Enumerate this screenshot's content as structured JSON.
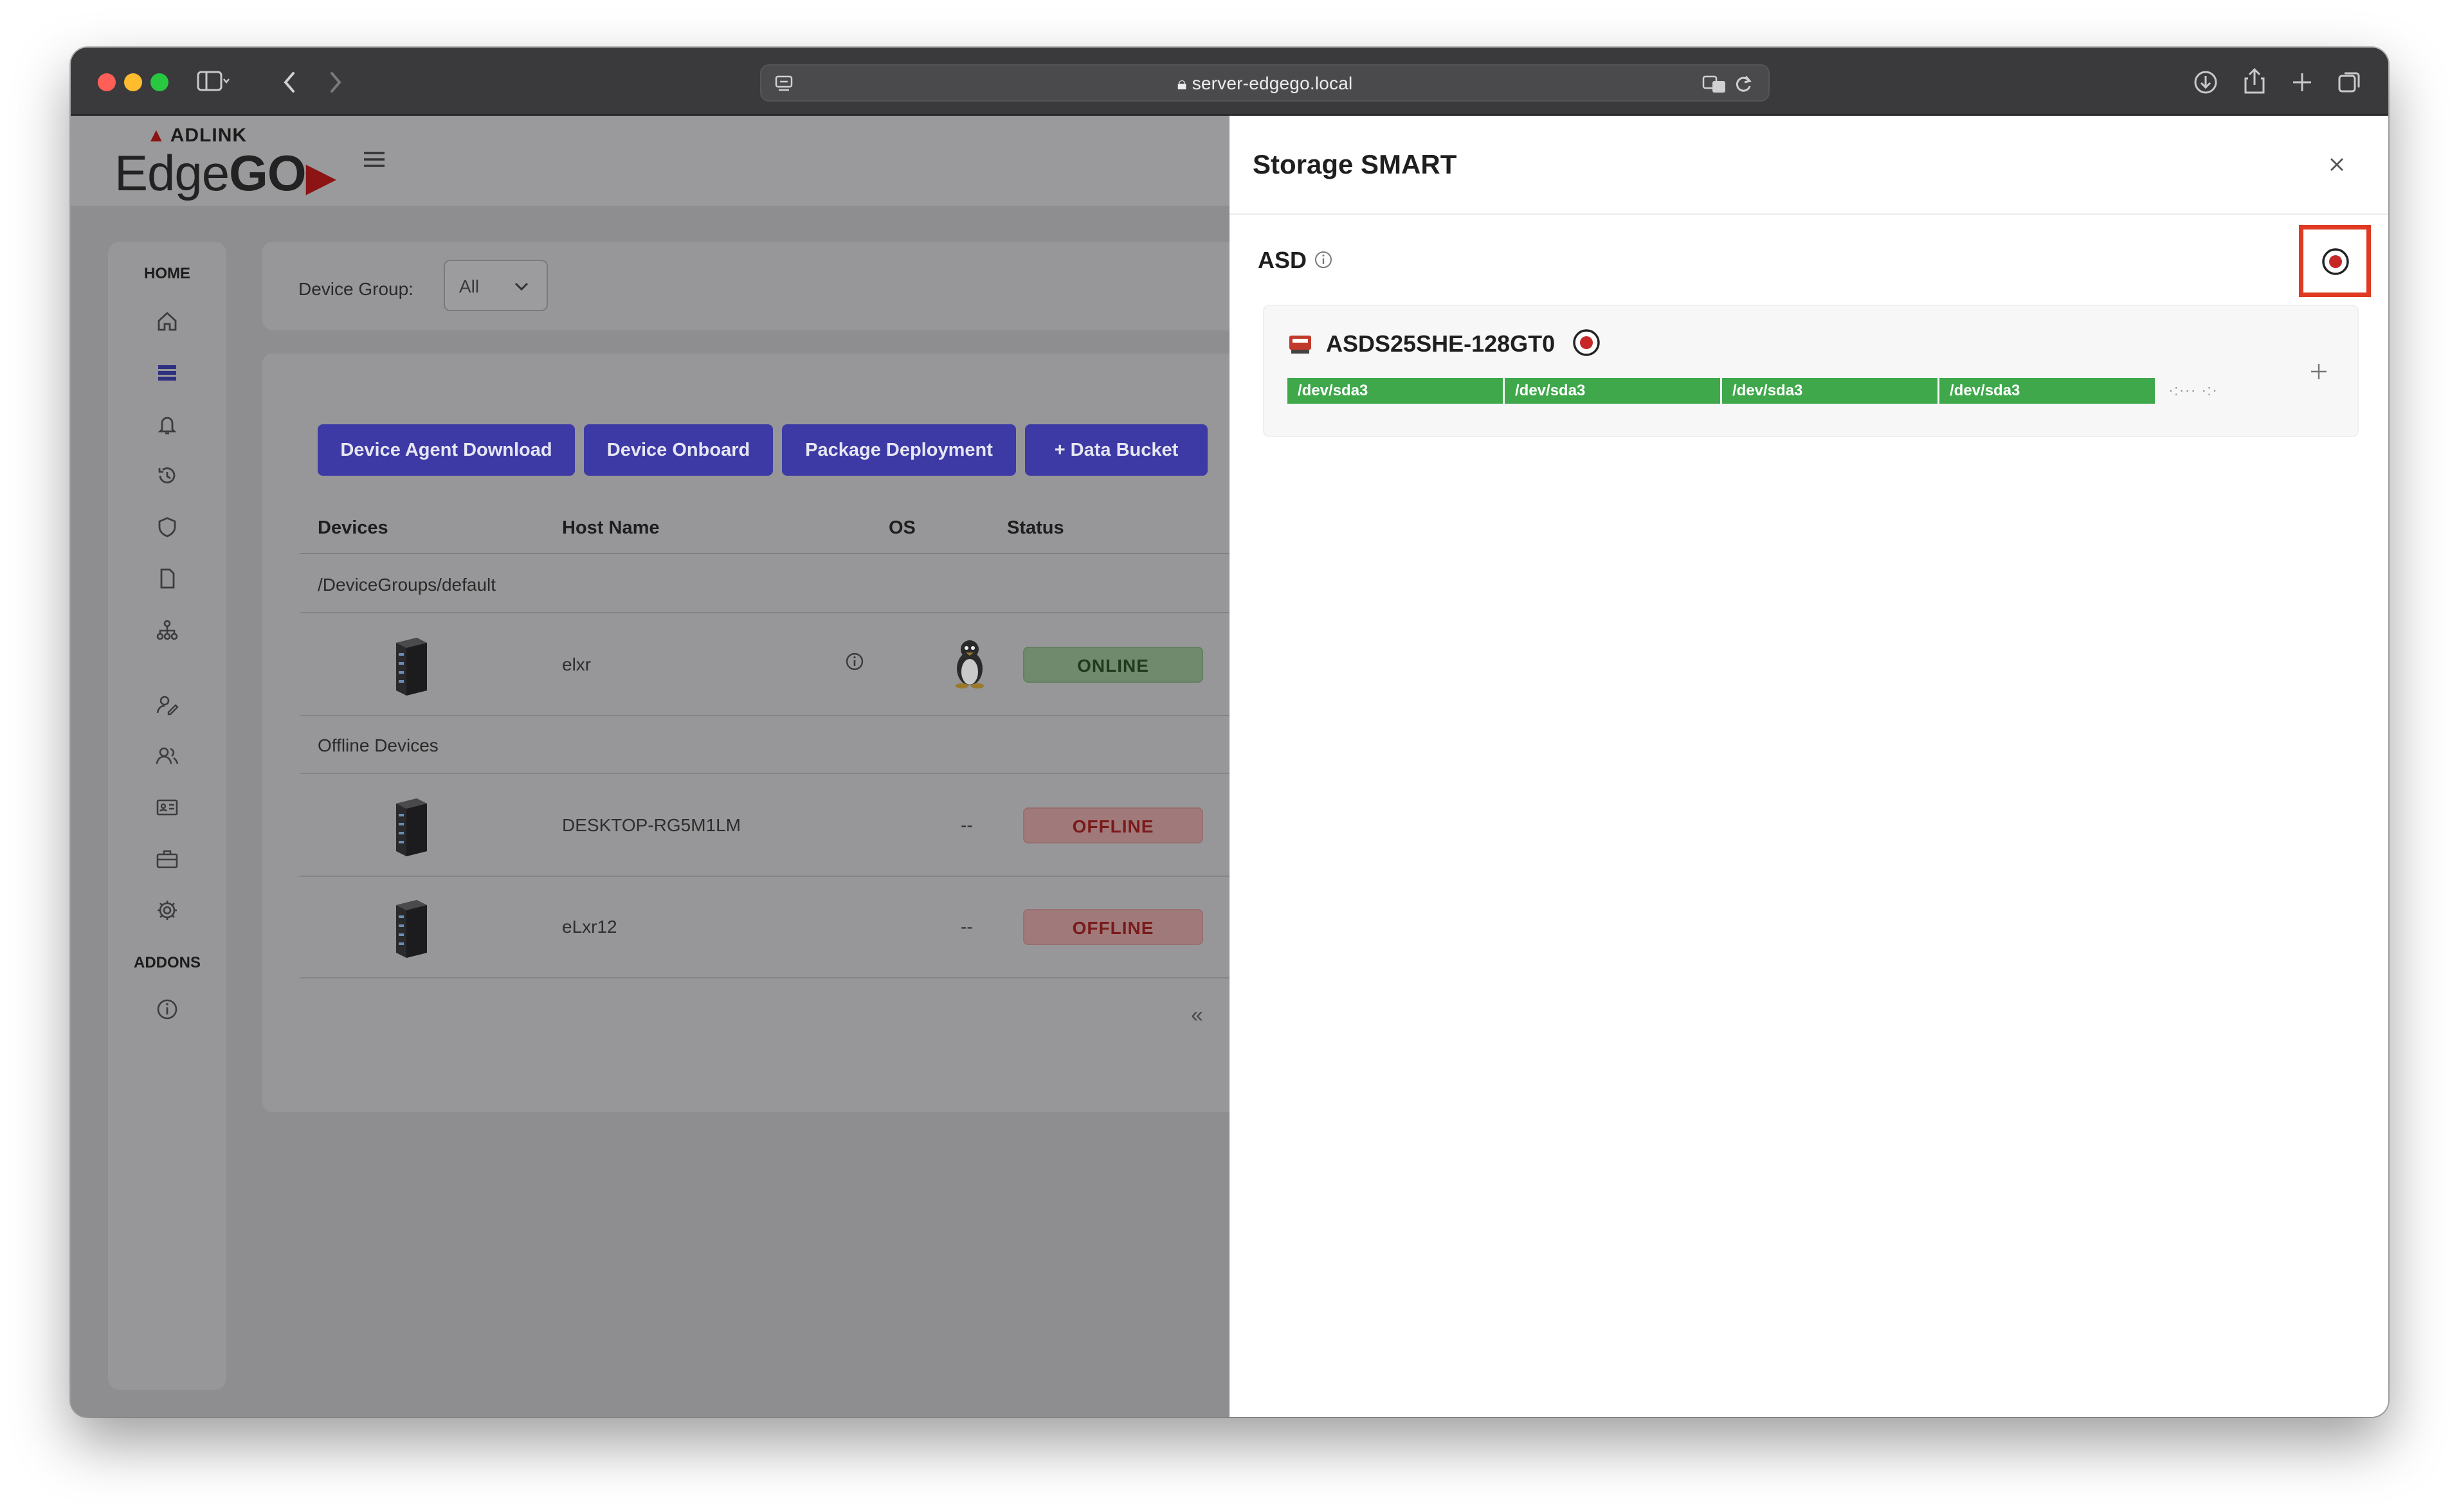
{
  "browser": {
    "url": "server-edgego.local"
  },
  "app": {
    "brand_small": "ADLINK",
    "brand_name_part1": "Edge",
    "brand_name_part2": "GO",
    "brand_arrow": "▶"
  },
  "sidebar": {
    "home_label": "HOME",
    "addons_label": "ADDONS",
    "icons": [
      "home-icon",
      "list-icon",
      "bell-icon",
      "history-icon",
      "shield-icon",
      "document-icon",
      "network-icon",
      "user-edit-icon",
      "users-icon",
      "id-card-icon",
      "briefcase-icon",
      "gear-icon",
      "info-icon"
    ]
  },
  "filter": {
    "label": "Device Group:",
    "value": "All"
  },
  "toolbar": {
    "agent_download": "Device Agent Download",
    "onboard": "Device Onboard",
    "package_deployment": "Package Deployment",
    "data_bucket": "+ Data Bucket"
  },
  "table": {
    "headers": [
      "Devices",
      "Host Name",
      "OS",
      "Status"
    ],
    "groups": [
      {
        "label": "/DeviceGroups/default",
        "rows": [
          {
            "host": "elxr",
            "os": "linux",
            "status": "ONLINE"
          }
        ]
      },
      {
        "label": "Offline Devices",
        "rows": [
          {
            "host": "DESKTOP-RG5M1LM",
            "os": "--",
            "status": "OFFLINE"
          },
          {
            "host": "eLxr12",
            "os": "--",
            "status": "OFFLINE"
          }
        ]
      }
    ]
  },
  "pagination": {
    "first": "«",
    "prev": "‹"
  },
  "drawer": {
    "title": "Storage SMART",
    "section_label": "ASD",
    "device": {
      "model": "ASDS25SHE-128GT0",
      "partitions": [
        "/dev/sda3",
        "/dev/sda3",
        "/dev/sda3",
        "/dev/sda3"
      ],
      "remaining_label": "·:··· ·:·"
    }
  },
  "colors": {
    "accent_button": "#3d3aa6",
    "partition_green": "#3fa84b",
    "highlight_red": "#e03a22",
    "radio_red": "#c62828"
  }
}
